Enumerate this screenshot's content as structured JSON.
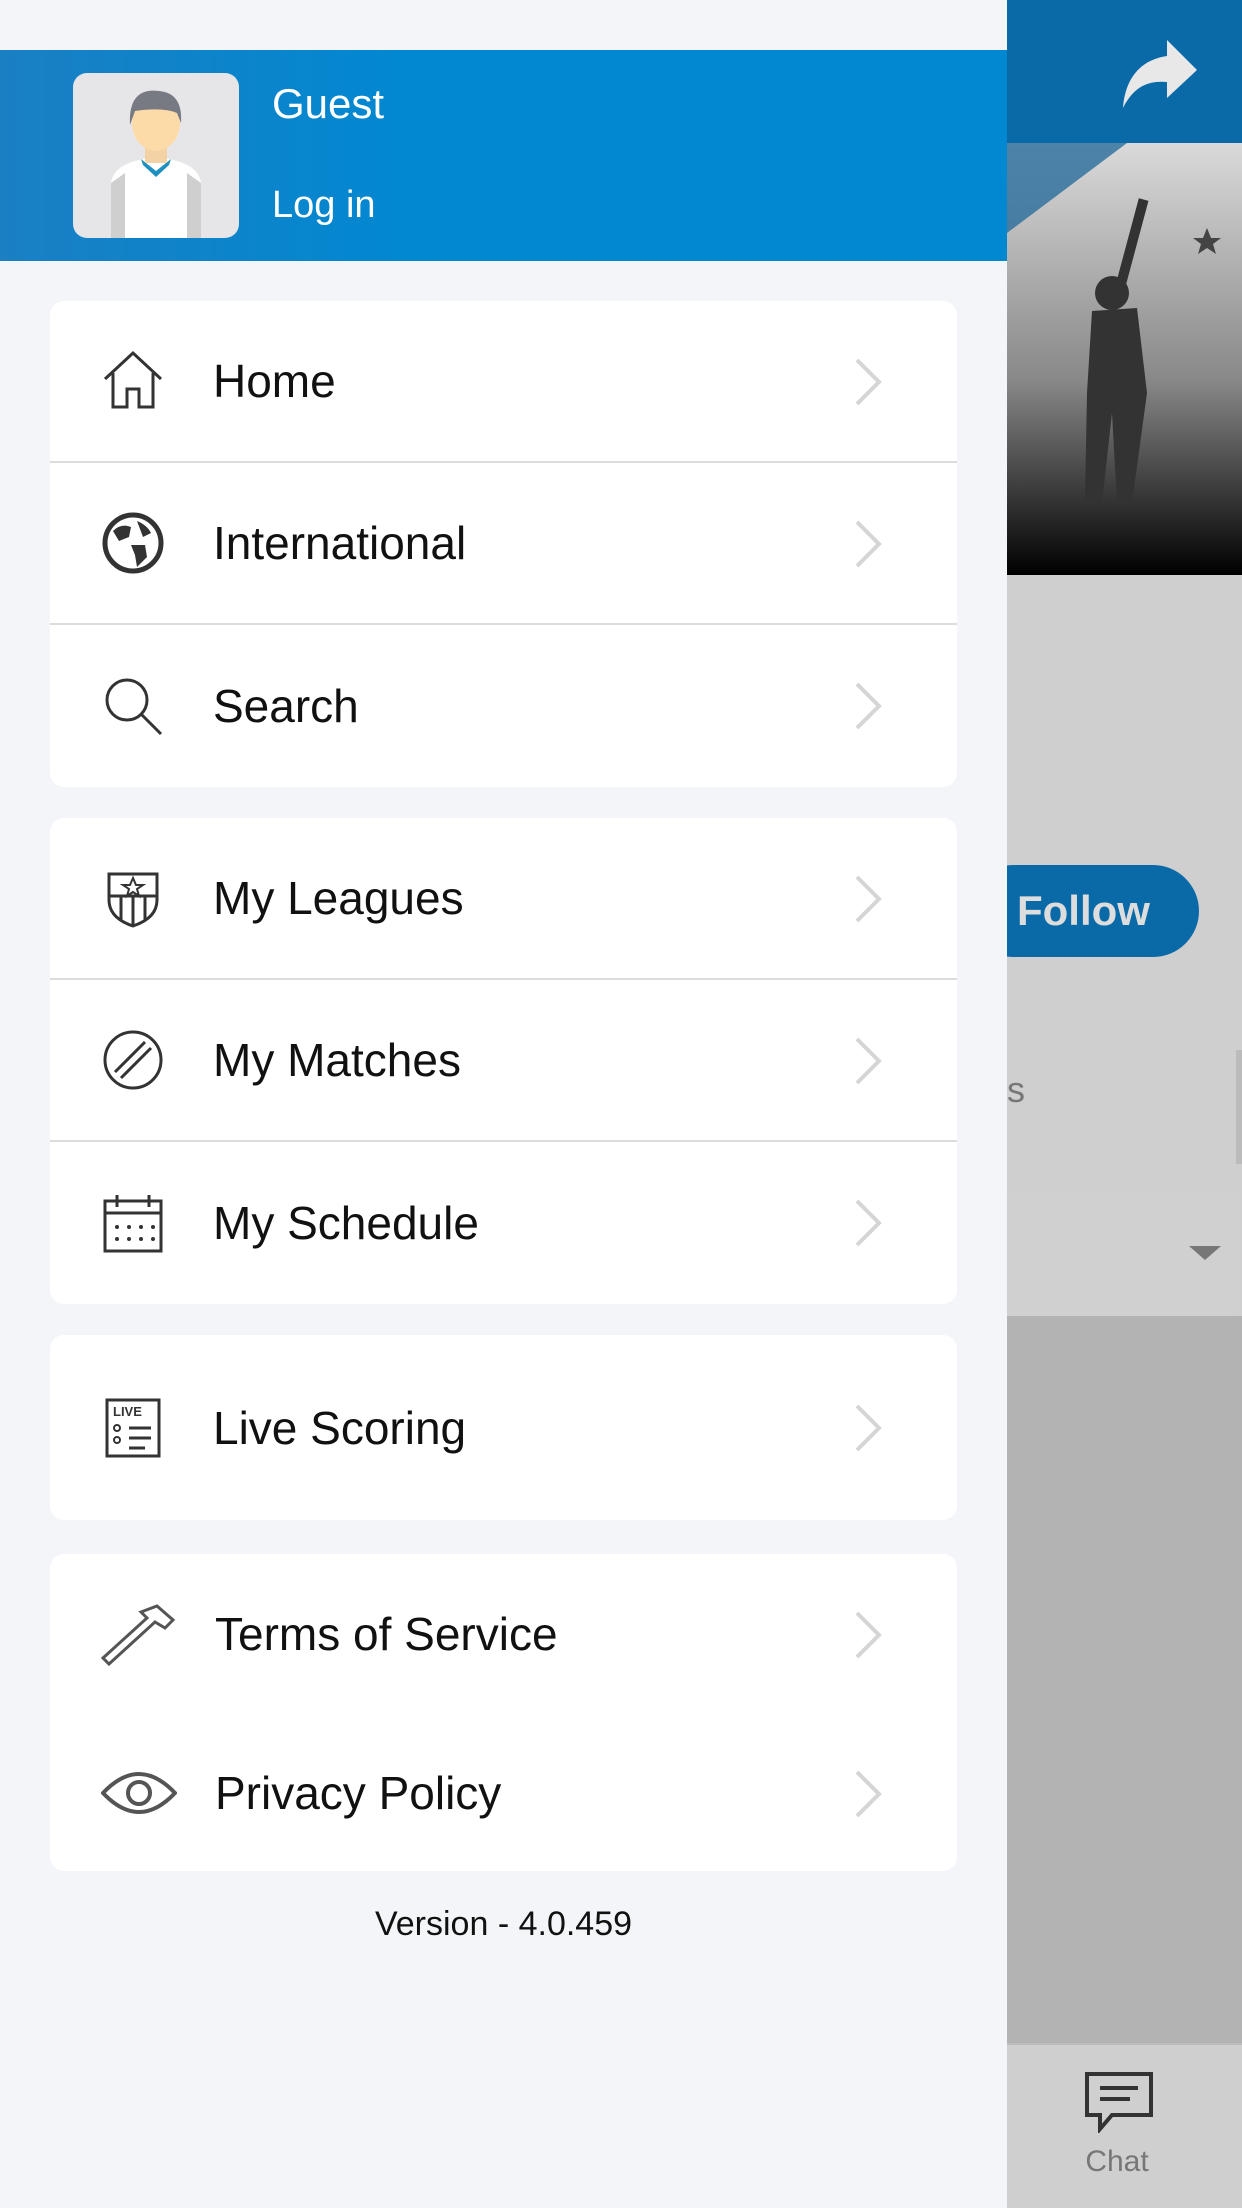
{
  "background_screen": {
    "follow_label": "Follow",
    "tab_partial_text": "s",
    "bottom_nav": {
      "chat_label": "Chat"
    },
    "colors": {
      "top_bar": "#0a6aa8",
      "overlay_gray": "#b3b3b3"
    }
  },
  "drawer": {
    "user": {
      "name": "Guest",
      "login_label": "Log in"
    },
    "groups": [
      [
        {
          "label": "Home",
          "icon": "home-icon"
        },
        {
          "label": "International",
          "icon": "globe-icon"
        },
        {
          "label": "Search",
          "icon": "search-icon"
        }
      ],
      [
        {
          "label": "My Leagues",
          "icon": "shield-icon"
        },
        {
          "label": "My Matches",
          "icon": "ball-icon"
        },
        {
          "label": "My Schedule",
          "icon": "calendar-icon"
        }
      ],
      [
        {
          "label": "Live Scoring",
          "icon": "live-scoreboard-icon"
        }
      ],
      [
        {
          "label": "Terms of Service",
          "icon": "hammer-icon"
        },
        {
          "label": "Privacy Policy",
          "icon": "eye-icon"
        }
      ]
    ],
    "version": "Version - 4.0.459",
    "colors": {
      "header": "#0288d1",
      "background": "#f3f5f9"
    }
  }
}
